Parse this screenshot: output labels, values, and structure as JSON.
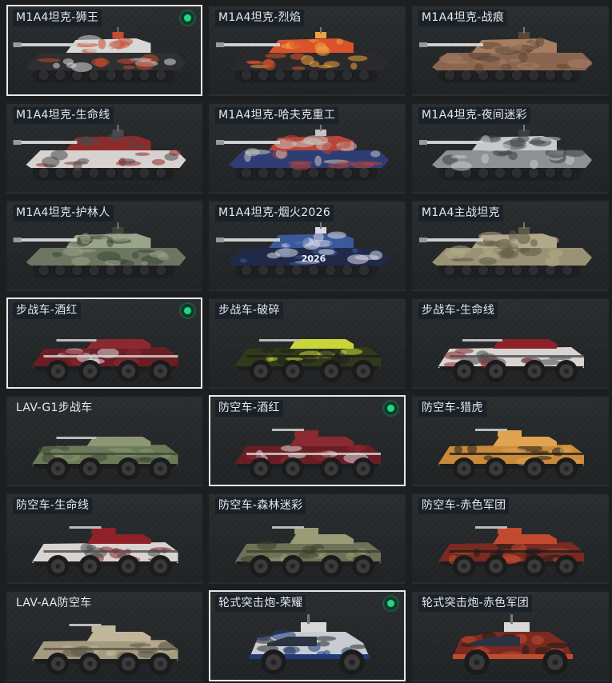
{
  "skins": [
    {
      "label": "M1A4坦克-狮王",
      "type": "tank",
      "selected": true,
      "equipped": true,
      "colors": {
        "body": "#2e2f31",
        "accent": "#d8d8d8",
        "detail": "#c94a2e"
      },
      "icon": "tank-icon",
      "decal_text": ""
    },
    {
      "label": "M1A4坦克-烈焰",
      "type": "tank",
      "selected": false,
      "equipped": false,
      "colors": {
        "body": "#2a2a2c",
        "accent": "#d9542a",
        "detail": "#f0a040"
      },
      "icon": "tank-icon",
      "decal_text": ""
    },
    {
      "label": "M1A4坦克-战痕",
      "type": "tank",
      "selected": false,
      "equipped": false,
      "colors": {
        "body": "#8a6650",
        "accent": "#a57d60",
        "detail": "#5d4536"
      },
      "icon": "tank-icon",
      "decal_text": ""
    },
    {
      "label": "M1A4坦克-生命线",
      "type": "tank",
      "selected": false,
      "equipped": false,
      "colors": {
        "body": "#d7d2cf",
        "accent": "#8e2a2a",
        "detail": "#4a4a4c"
      },
      "icon": "tank-icon",
      "decal_text": ""
    },
    {
      "label": "M1A4坦克-哈夫克重工",
      "type": "tank",
      "selected": false,
      "equipped": false,
      "colors": {
        "body": "#2e3e74",
        "accent": "#b8463a",
        "detail": "#c7c4c0"
      },
      "icon": "tank-icon",
      "decal_text": ""
    },
    {
      "label": "M1A4坦克-夜间迷彩",
      "type": "tank",
      "selected": false,
      "equipped": false,
      "colors": {
        "body": "#8e9194",
        "accent": "#c8c9ca",
        "detail": "#3c3f42"
      },
      "icon": "tank-icon",
      "decal_text": ""
    },
    {
      "label": "M1A4坦克-护林人",
      "type": "tank",
      "selected": false,
      "equipped": false,
      "colors": {
        "body": "#6c7660",
        "accent": "#9aa48a",
        "detail": "#3d4536"
      },
      "icon": "tank-icon",
      "decal_text": ""
    },
    {
      "label": "M1A4坦克-烟火2026",
      "type": "tank",
      "selected": false,
      "equipped": false,
      "colors": {
        "body": "#1f2a48",
        "accent": "#3a5a9a",
        "detail": "#d8d8e8"
      },
      "icon": "tank-icon",
      "decal_text": "2026"
    },
    {
      "label": "M1A4主战坦克",
      "type": "tank",
      "selected": false,
      "equipped": false,
      "colors": {
        "body": "#9a9274",
        "accent": "#b1a98a",
        "detail": "#5d5845"
      },
      "icon": "tank-icon",
      "decal_text": ""
    },
    {
      "label": "步战车-酒红",
      "type": "ifv",
      "selected": true,
      "equipped": true,
      "colors": {
        "body": "#6a1e24",
        "accent": "#8a2a30",
        "detail": "#d9d9d9"
      },
      "icon": "ifv-icon",
      "decal_text": ""
    },
    {
      "label": "步战车-破碎",
      "type": "ifv",
      "selected": false,
      "equipped": false,
      "colors": {
        "body": "#2f3a1a",
        "accent": "#c9d63a",
        "detail": "#1e1e1e"
      },
      "icon": "ifv-icon",
      "decal_text": ""
    },
    {
      "label": "步战车-生命线",
      "type": "ifv",
      "selected": false,
      "equipped": false,
      "colors": {
        "body": "#d8d4d2",
        "accent": "#8e2228",
        "detail": "#4a4a4c"
      },
      "icon": "ifv-icon",
      "decal_text": ""
    },
    {
      "label": "LAV-G1步战车",
      "type": "ifv",
      "selected": false,
      "equipped": false,
      "colors": {
        "body": "#6b7a58",
        "accent": "#8a9772",
        "detail": "#3f4734"
      },
      "icon": "ifv-icon",
      "decal_text": ""
    },
    {
      "label": "防空车-酒红",
      "type": "aa",
      "selected": true,
      "equipped": true,
      "colors": {
        "body": "#6a1e24",
        "accent": "#8a2a30",
        "detail": "#d9d9d9"
      },
      "icon": "aa-vehicle-icon",
      "decal_text": ""
    },
    {
      "label": "防空车-猎虎",
      "type": "aa",
      "selected": false,
      "equipped": false,
      "colors": {
        "body": "#c98a3a",
        "accent": "#e0a450",
        "detail": "#1e1e1e"
      },
      "icon": "aa-vehicle-icon",
      "decal_text": ""
    },
    {
      "label": "防空车-生命线",
      "type": "aa",
      "selected": false,
      "equipped": false,
      "colors": {
        "body": "#d8d4d2",
        "accent": "#8e2228",
        "detail": "#4a4a4c"
      },
      "icon": "aa-vehicle-icon",
      "decal_text": ""
    },
    {
      "label": "防空车-森林迷彩",
      "type": "aa",
      "selected": false,
      "equipped": false,
      "colors": {
        "body": "#6d7256",
        "accent": "#9a9c78",
        "detail": "#3c3f2e"
      },
      "icon": "aa-vehicle-icon",
      "decal_text": ""
    },
    {
      "label": "防空车-赤色军团",
      "type": "aa",
      "selected": false,
      "equipped": false,
      "colors": {
        "body": "#7a2a20",
        "accent": "#c24a30",
        "detail": "#1c1c1c"
      },
      "icon": "aa-vehicle-icon",
      "decal_text": ""
    },
    {
      "label": "LAV-AA防空车",
      "type": "aa",
      "selected": false,
      "equipped": false,
      "colors": {
        "body": "#a39a80",
        "accent": "#c0b79a",
        "detail": "#5a5444"
      },
      "icon": "aa-vehicle-icon",
      "decal_text": ""
    },
    {
      "label": "轮式突击炮-荣耀",
      "type": "assault",
      "selected": true,
      "equipped": true,
      "colors": {
        "body": "#c8ccd2",
        "accent": "#1e3a7a",
        "detail": "#2a2a2e"
      },
      "icon": "assault-gun-icon",
      "decal_text": ""
    },
    {
      "label": "轮式突击炮-赤色军团",
      "type": "assault",
      "selected": false,
      "equipped": false,
      "colors": {
        "body": "#7a2a20",
        "accent": "#c24a30",
        "detail": "#1c1c1c"
      },
      "icon": "assault-gun-icon",
      "decal_text": ""
    }
  ]
}
